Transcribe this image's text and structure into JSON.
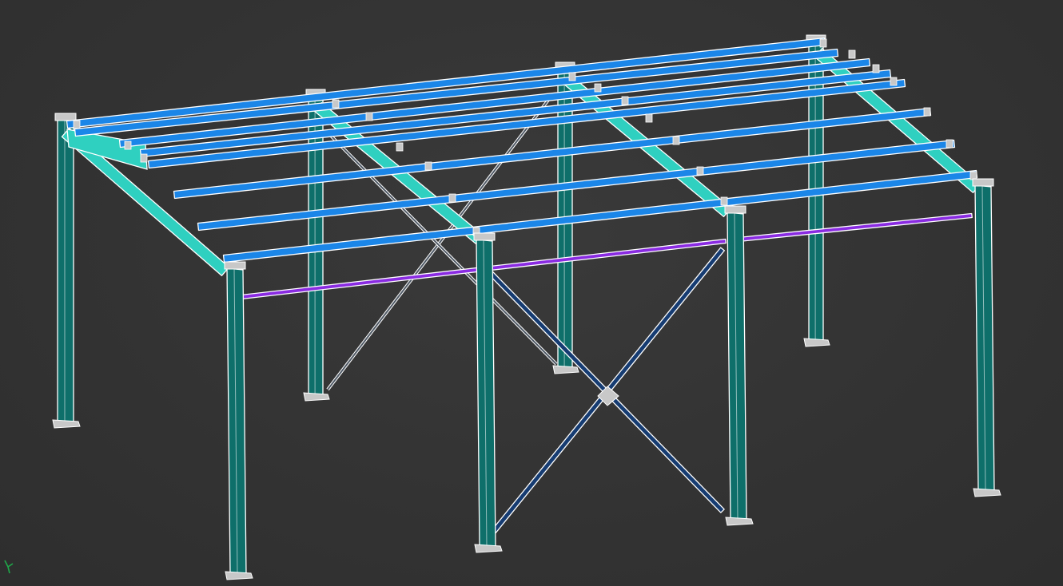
{
  "viewport": {
    "background": "#333333",
    "projection": "isometric",
    "render_mode": "shaded-with-edges"
  },
  "model": {
    "type": "steel-frame-structure",
    "structure": "portal-frame-shed",
    "frames": 4,
    "purlins_per_slope": 8,
    "bracing": "x-bracing-front-bay",
    "colors": {
      "column": "#0e6f6a",
      "rafter": "#2fd0c0",
      "purlin": "#1b86e8",
      "eave_strut": "#8a2be2",
      "brace": "#163c72",
      "edge": "#ffffff",
      "plate": "#c8c8c8"
    }
  },
  "triad": {
    "icon": "axis-triad-icon",
    "color": "#1fa84a"
  }
}
